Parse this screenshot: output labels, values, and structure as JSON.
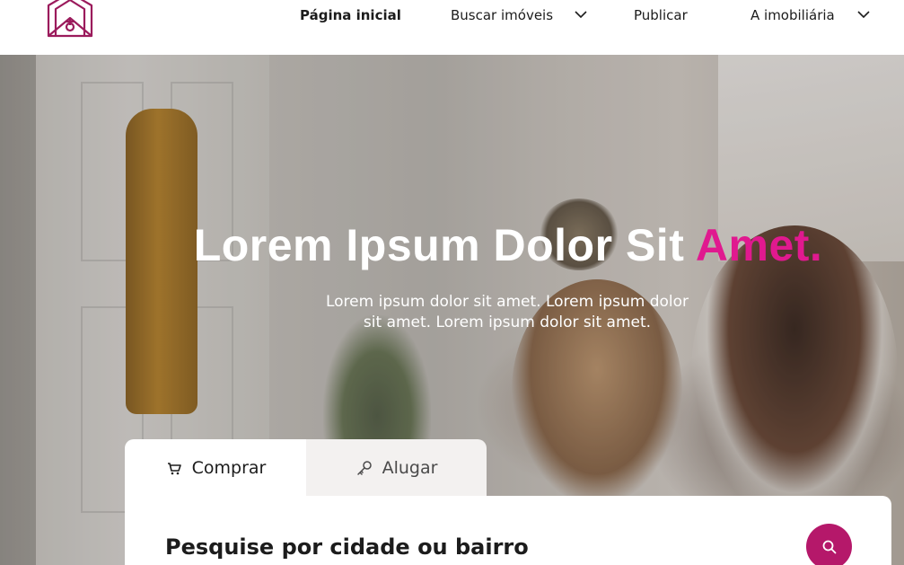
{
  "header": {
    "logo": {
      "icon": "house-logo-icon",
      "color": "#9b1b5c"
    },
    "nav": {
      "home": "Página inicial",
      "buscar": "Buscar imóveis",
      "publicar": "Publicar",
      "imobiliaria": "A imobiliária"
    }
  },
  "hero": {
    "title_main": "Lorem Ipsum Dolor Sit ",
    "title_accent": "Amet.",
    "accent_color": "#e0198f",
    "subtitle": "Lorem ipsum dolor sit amet. Lorem ipsum dolor sit amet. Lorem ipsum dolor sit amet."
  },
  "search": {
    "tabs": [
      {
        "label": "Comprar",
        "icon": "cart-icon",
        "active": true
      },
      {
        "label": "Alugar",
        "icon": "key-icon",
        "active": false
      }
    ],
    "title": "Pesquise por cidade ou bairro",
    "button_icon": "search-icon",
    "button_color": "#b5186a"
  }
}
